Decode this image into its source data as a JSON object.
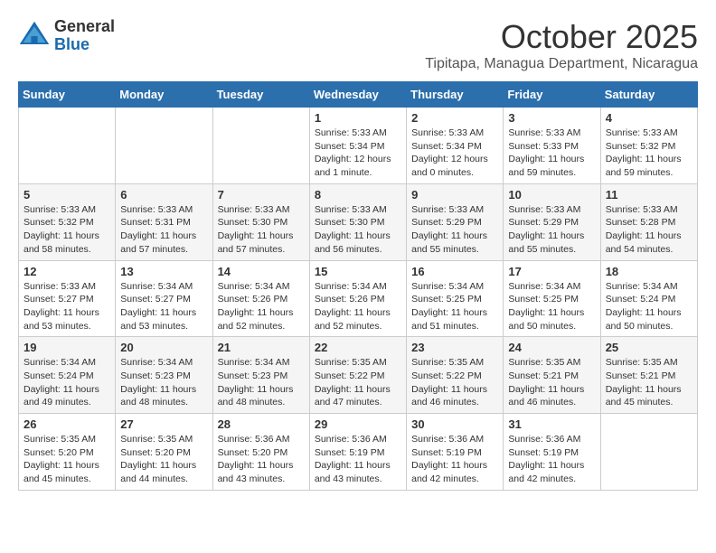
{
  "logo": {
    "general": "General",
    "blue": "Blue"
  },
  "title": "October 2025",
  "location": "Tipitapa, Managua Department, Nicaragua",
  "days_of_week": [
    "Sunday",
    "Monday",
    "Tuesday",
    "Wednesday",
    "Thursday",
    "Friday",
    "Saturday"
  ],
  "weeks": [
    [
      {
        "day": "",
        "info": ""
      },
      {
        "day": "",
        "info": ""
      },
      {
        "day": "",
        "info": ""
      },
      {
        "day": "1",
        "info": "Sunrise: 5:33 AM\nSunset: 5:34 PM\nDaylight: 12 hours and 1 minute."
      },
      {
        "day": "2",
        "info": "Sunrise: 5:33 AM\nSunset: 5:34 PM\nDaylight: 12 hours and 0 minutes."
      },
      {
        "day": "3",
        "info": "Sunrise: 5:33 AM\nSunset: 5:33 PM\nDaylight: 11 hours and 59 minutes."
      },
      {
        "day": "4",
        "info": "Sunrise: 5:33 AM\nSunset: 5:32 PM\nDaylight: 11 hours and 59 minutes."
      }
    ],
    [
      {
        "day": "5",
        "info": "Sunrise: 5:33 AM\nSunset: 5:32 PM\nDaylight: 11 hours and 58 minutes."
      },
      {
        "day": "6",
        "info": "Sunrise: 5:33 AM\nSunset: 5:31 PM\nDaylight: 11 hours and 57 minutes."
      },
      {
        "day": "7",
        "info": "Sunrise: 5:33 AM\nSunset: 5:30 PM\nDaylight: 11 hours and 57 minutes."
      },
      {
        "day": "8",
        "info": "Sunrise: 5:33 AM\nSunset: 5:30 PM\nDaylight: 11 hours and 56 minutes."
      },
      {
        "day": "9",
        "info": "Sunrise: 5:33 AM\nSunset: 5:29 PM\nDaylight: 11 hours and 55 minutes."
      },
      {
        "day": "10",
        "info": "Sunrise: 5:33 AM\nSunset: 5:29 PM\nDaylight: 11 hours and 55 minutes."
      },
      {
        "day": "11",
        "info": "Sunrise: 5:33 AM\nSunset: 5:28 PM\nDaylight: 11 hours and 54 minutes."
      }
    ],
    [
      {
        "day": "12",
        "info": "Sunrise: 5:33 AM\nSunset: 5:27 PM\nDaylight: 11 hours and 53 minutes."
      },
      {
        "day": "13",
        "info": "Sunrise: 5:34 AM\nSunset: 5:27 PM\nDaylight: 11 hours and 53 minutes."
      },
      {
        "day": "14",
        "info": "Sunrise: 5:34 AM\nSunset: 5:26 PM\nDaylight: 11 hours and 52 minutes."
      },
      {
        "day": "15",
        "info": "Sunrise: 5:34 AM\nSunset: 5:26 PM\nDaylight: 11 hours and 52 minutes."
      },
      {
        "day": "16",
        "info": "Sunrise: 5:34 AM\nSunset: 5:25 PM\nDaylight: 11 hours and 51 minutes."
      },
      {
        "day": "17",
        "info": "Sunrise: 5:34 AM\nSunset: 5:25 PM\nDaylight: 11 hours and 50 minutes."
      },
      {
        "day": "18",
        "info": "Sunrise: 5:34 AM\nSunset: 5:24 PM\nDaylight: 11 hours and 50 minutes."
      }
    ],
    [
      {
        "day": "19",
        "info": "Sunrise: 5:34 AM\nSunset: 5:24 PM\nDaylight: 11 hours and 49 minutes."
      },
      {
        "day": "20",
        "info": "Sunrise: 5:34 AM\nSunset: 5:23 PM\nDaylight: 11 hours and 48 minutes."
      },
      {
        "day": "21",
        "info": "Sunrise: 5:34 AM\nSunset: 5:23 PM\nDaylight: 11 hours and 48 minutes."
      },
      {
        "day": "22",
        "info": "Sunrise: 5:35 AM\nSunset: 5:22 PM\nDaylight: 11 hours and 47 minutes."
      },
      {
        "day": "23",
        "info": "Sunrise: 5:35 AM\nSunset: 5:22 PM\nDaylight: 11 hours and 46 minutes."
      },
      {
        "day": "24",
        "info": "Sunrise: 5:35 AM\nSunset: 5:21 PM\nDaylight: 11 hours and 46 minutes."
      },
      {
        "day": "25",
        "info": "Sunrise: 5:35 AM\nSunset: 5:21 PM\nDaylight: 11 hours and 45 minutes."
      }
    ],
    [
      {
        "day": "26",
        "info": "Sunrise: 5:35 AM\nSunset: 5:20 PM\nDaylight: 11 hours and 45 minutes."
      },
      {
        "day": "27",
        "info": "Sunrise: 5:35 AM\nSunset: 5:20 PM\nDaylight: 11 hours and 44 minutes."
      },
      {
        "day": "28",
        "info": "Sunrise: 5:36 AM\nSunset: 5:20 PM\nDaylight: 11 hours and 43 minutes."
      },
      {
        "day": "29",
        "info": "Sunrise: 5:36 AM\nSunset: 5:19 PM\nDaylight: 11 hours and 43 minutes."
      },
      {
        "day": "30",
        "info": "Sunrise: 5:36 AM\nSunset: 5:19 PM\nDaylight: 11 hours and 42 minutes."
      },
      {
        "day": "31",
        "info": "Sunrise: 5:36 AM\nSunset: 5:19 PM\nDaylight: 11 hours and 42 minutes."
      },
      {
        "day": "",
        "info": ""
      }
    ]
  ]
}
